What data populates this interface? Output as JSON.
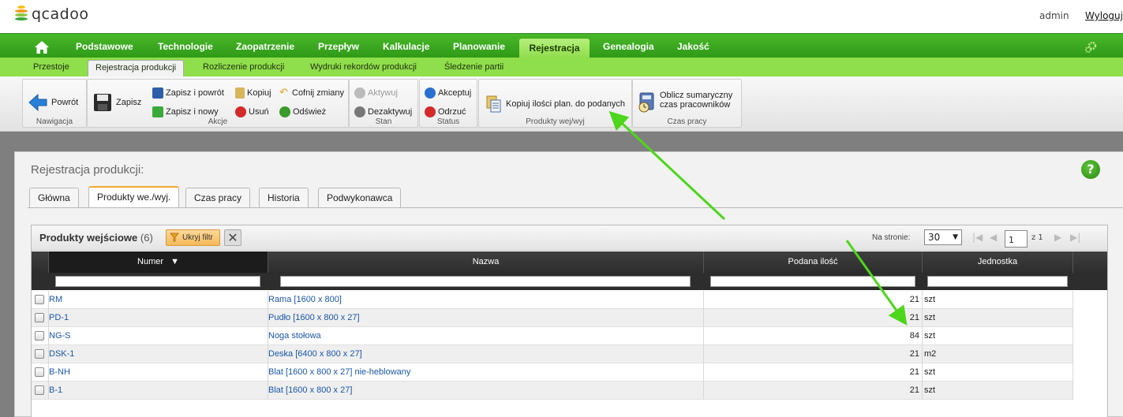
{
  "app": {
    "logo_text": "qcadoo",
    "user": "admin",
    "logout": "Wyloguj"
  },
  "main_nav": {
    "items": [
      "Podstawowe",
      "Technologie",
      "Zaopatrzenie",
      "Przepływ",
      "Kalkulacje",
      "Planowanie",
      "Rejestracja",
      "Genealogia",
      "Jakość"
    ],
    "active": "Rejestracja"
  },
  "sub_nav": {
    "items": [
      "Przestoje",
      "Rejestracja produkcji",
      "Rozliczenie produkcji",
      "Wydruki rekordów produkcji",
      "Śledzenie partii"
    ],
    "active": "Rejestracja produkcji"
  },
  "ribbon": {
    "nawigacja": {
      "label": "Nawigacja",
      "back": "Powrót"
    },
    "akcje": {
      "label": "Akcje",
      "save": "Zapisz",
      "save_back": "Zapisz i powrót",
      "save_new": "Zapisz i nowy",
      "copy": "Kopiuj",
      "delete": "Usuń",
      "undo": "Cofnij zmiany",
      "refresh": "Odśwież"
    },
    "stan": {
      "label": "Stan",
      "activate": "Aktywuj",
      "deactivate": "Dezaktywuj"
    },
    "status": {
      "label": "Status",
      "accept": "Akceptuj",
      "reject": "Odrzuć"
    },
    "produkty": {
      "label": "Produkty wej/wyj",
      "copy_qty": "Kopiuj ilości plan. do podanych"
    },
    "czas_pracy": {
      "label": "Czas pracy",
      "calc_line1": "Oblicz sumaryczny",
      "calc_line2": "czas pracowników"
    }
  },
  "form": {
    "title": "Rejestracja produkcji:",
    "help": "?",
    "tabs": [
      "Główna",
      "Produkty we./wyj.",
      "Czas pracy",
      "Historia",
      "Podwykonawca"
    ],
    "active_tab": "Produkty we./wyj."
  },
  "grid": {
    "title": "Produkty wejściowe",
    "count": "(6)",
    "filter_button": "Ukryj filtr",
    "per_page_label": "Na stronie:",
    "per_page": "30",
    "page": "1",
    "page_total": "z 1",
    "columns": [
      "Numer",
      "Nazwa",
      "Podana ilość",
      "Jednostka"
    ],
    "rows": [
      {
        "number": "RM",
        "name": "Rama [1600 x 800]",
        "qty": "21",
        "unit": "szt"
      },
      {
        "number": "PD-1",
        "name": "Pudło [1600 x 800 x 27]",
        "qty": "21",
        "unit": "szt"
      },
      {
        "number": "NG-S",
        "name": "Noga stołowa",
        "qty": "84",
        "unit": "szt"
      },
      {
        "number": "DSK-1",
        "name": "Deska [6400 x 800 x 27]",
        "qty": "21",
        "unit": "m2"
      },
      {
        "number": "B-NH",
        "name": "Blat [1600 x 800 x 27] nie-heblowany",
        "qty": "21",
        "unit": "szt"
      },
      {
        "number": "B-1",
        "name": "Blat [1600 x 800 x 27]",
        "qty": "21",
        "unit": "szt"
      }
    ]
  },
  "colors": {
    "nav_green": "#3aab1e",
    "active_tab": "#a6e86a",
    "annotation_arrow": "#4dd61c",
    "link": "#1a56a8"
  }
}
